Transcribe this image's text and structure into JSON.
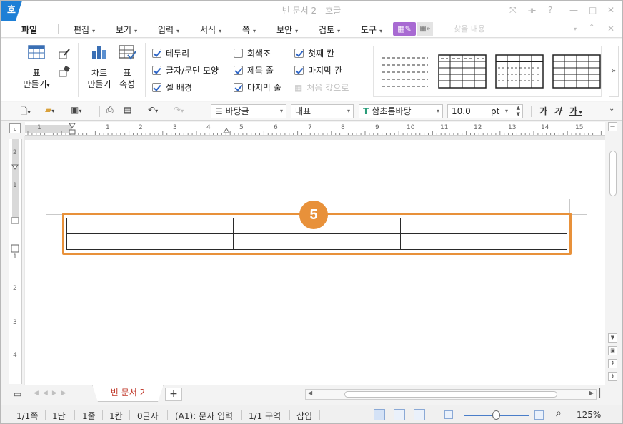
{
  "titlebar": {
    "app_logo": "호",
    "title": "빈 문서 2 - 호글",
    "controls": [
      "⤧",
      "⟛",
      "?",
      "—",
      "□",
      "✕"
    ]
  },
  "menubar": {
    "items": [
      {
        "label": "파일",
        "has_arrow": false
      },
      {
        "label": "편집",
        "has_arrow": true
      },
      {
        "label": "보기",
        "has_arrow": true
      },
      {
        "label": "입력",
        "has_arrow": true
      },
      {
        "label": "서식",
        "has_arrow": true
      },
      {
        "label": "쪽",
        "has_arrow": true
      },
      {
        "label": "보안",
        "has_arrow": true
      },
      {
        "label": "검토",
        "has_arrow": true
      },
      {
        "label": "도구",
        "has_arrow": true
      }
    ],
    "search_placeholder": "찾을 내용"
  },
  "ribbon": {
    "table_create": {
      "line1": "표",
      "line2": "만들기"
    },
    "chart_create": {
      "line1": "차트",
      "line2": "만들기"
    },
    "table_props": {
      "line1": "표",
      "line2": "속성"
    },
    "checks_col1": [
      {
        "label": "테두리",
        "checked": true
      },
      {
        "label": "글자/문단 모양",
        "checked": true
      },
      {
        "label": "셀 배경",
        "checked": true
      }
    ],
    "checks_col2": [
      {
        "label": "회색조",
        "checked": false
      },
      {
        "label": "제목 줄",
        "checked": true
      },
      {
        "label": "마지막 줄",
        "checked": true
      }
    ],
    "checks_col3": [
      {
        "label": "첫째 칸",
        "checked": true
      },
      {
        "label": "마지막 칸",
        "checked": true
      },
      {
        "label": "처음 값으로",
        "checked": false,
        "disabled": true
      }
    ]
  },
  "toolbar": {
    "style_combo": "바탕글",
    "para_combo": "대표",
    "font_combo": "함초롬바탕",
    "size_value": "10.0",
    "size_unit": "pt",
    "format_buttons": [
      "가",
      "가",
      "가"
    ]
  },
  "ruler": {
    "h_numbers": [
      "1",
      "1",
      "2",
      "3",
      "4",
      "5",
      "6",
      "7",
      "8",
      "9",
      "10",
      "11",
      "12",
      "13",
      "14",
      "15"
    ],
    "v_numbers": [
      "2",
      "1",
      "1",
      "2",
      "3",
      "4"
    ]
  },
  "document": {
    "step_badge": "5",
    "table": {
      "rows": 2,
      "cols": 3
    }
  },
  "tabbar": {
    "doc_tab": "빈 문서 2",
    "add_tab": "+"
  },
  "statusbar": {
    "page": "1/1쪽",
    "column": "1단",
    "line": "1줄",
    "cell_col": "1칸",
    "chars": "0글자",
    "mode": "(A1): 문자 입력",
    "section": "1/1 구역",
    "insert": "삽입",
    "zoom": "125%",
    "zoom_level_percent": 43
  },
  "colors": {
    "accent_orange": "#e8913a",
    "purple_button": "#a86ad2",
    "app_blue": "#1e7fd6",
    "check_blue": "#2f66c7"
  }
}
